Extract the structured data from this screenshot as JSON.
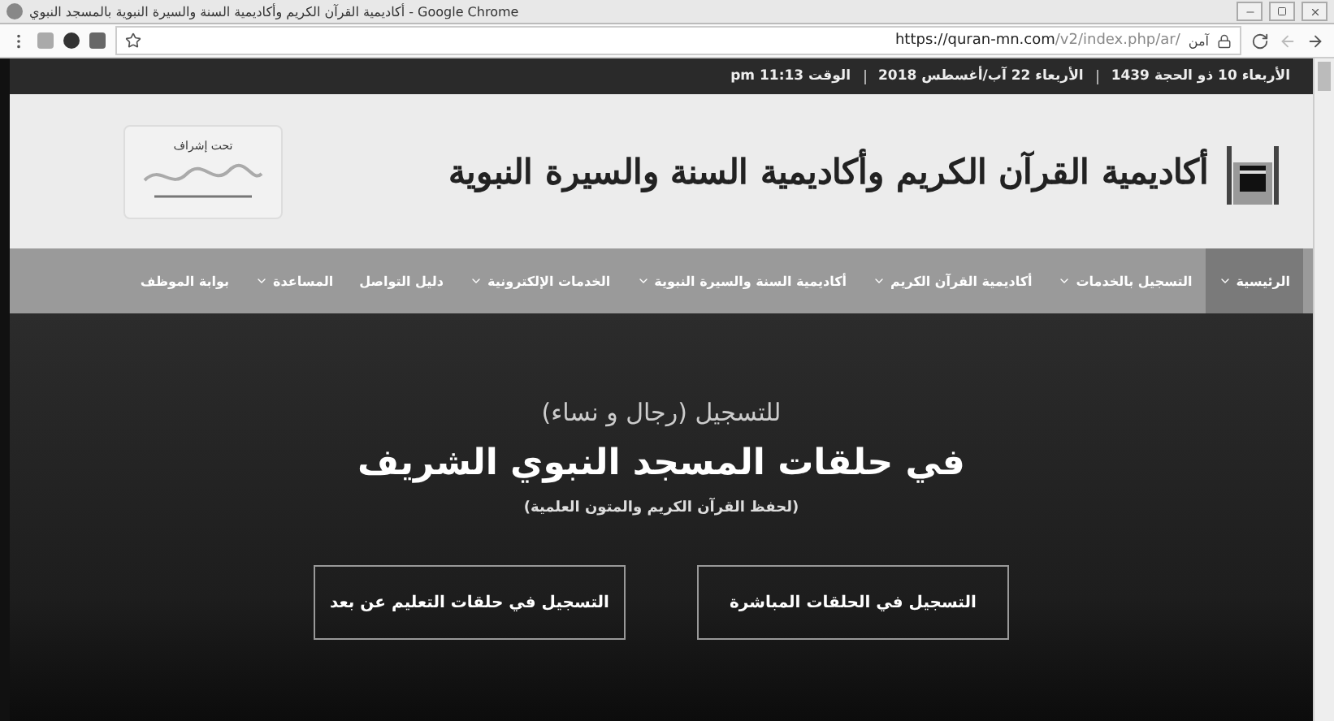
{
  "window": {
    "title": "أكاديمية القرآن الكريم وأكاديمية السنة والسيرة النبوية بالمسجد النبوي - Google Chrome"
  },
  "browser": {
    "url_host": "https://quran-mn.com",
    "url_path": "/v2/index.php/ar/",
    "secure_label": "آمن"
  },
  "date_bar": [
    "الأربعاء 10 ذو الحجة 1439",
    "الأربعاء 22 آب/أغسطس 2018",
    "الوقت 11:13 pm"
  ],
  "header": {
    "logo_text": "أكاديمية القرآن الكريم وأكاديمية السنة والسيرة النبوية",
    "supervision_label": "تحت إشراف"
  },
  "nav": [
    {
      "label": "الرئيسية",
      "dropdown": true,
      "selected": true
    },
    {
      "label": "التسجيل بالخدمات",
      "dropdown": true,
      "selected": false
    },
    {
      "label": "أكاديمية القرآن الكريم",
      "dropdown": true,
      "selected": false
    },
    {
      "label": "أكاديمية السنة والسيرة النبوية",
      "dropdown": true,
      "selected": false
    },
    {
      "label": "الخدمات الإلكترونية",
      "dropdown": true,
      "selected": false
    },
    {
      "label": "دليل التواصل",
      "dropdown": false,
      "selected": false
    },
    {
      "label": "المساعدة",
      "dropdown": true,
      "selected": false
    },
    {
      "label": "بوابة الموظف",
      "dropdown": false,
      "selected": false
    }
  ],
  "hero": {
    "kicker": "للتسجيل (رجال و نساء)",
    "heading": "في حلقات المسجد النبوي الشريف",
    "subheading": "(لحفظ القرآن الكريم والمتون العلمية)",
    "buttons": [
      "التسجيل في الحلقات المباشرة",
      "التسجيل في حلقات التعليم عن بعد"
    ]
  }
}
